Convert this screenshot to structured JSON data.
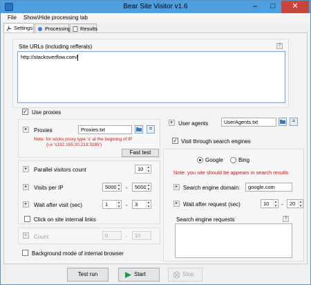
{
  "window": {
    "title": "Bear Site Visitor v1.6"
  },
  "menu": [
    "File",
    "Show\\Hide processing tab"
  ],
  "tabs": [
    "Settings",
    "Processing",
    "Results"
  ],
  "site_urls": {
    "label": "Site URLs (including refferals)",
    "value": "http://stackoverflow.com/"
  },
  "use_proxies": {
    "label": "Use proxies",
    "checked": true
  },
  "proxies": {
    "label": "Proxies",
    "file": "Proxies.txt",
    "note_line1": "Note: for socks proxy type 's' at the begining of IP",
    "note_line2": "(i.e 's192.155.20.213:3185')",
    "fast_test": "Fast test"
  },
  "parallel": {
    "label": "Parallel visitors count",
    "value": "10"
  },
  "visits_per_ip": {
    "label": "Visits per IP",
    "from": "5000",
    "to": "5000",
    "sep": "-"
  },
  "wait_after_visit": {
    "label": "Wait after visit (sec)",
    "from": "1",
    "to": "3",
    "sep": "-"
  },
  "click_internal": {
    "label": "Click on site internal links",
    "checked": false
  },
  "count": {
    "label": "Count",
    "from": "0",
    "to": "10",
    "sep": "-"
  },
  "background_mode": {
    "label": "Background mode of internal browser",
    "checked": false
  },
  "user_agents": {
    "label": "User agents",
    "file": "UserAgents.txt"
  },
  "search_engines": {
    "label": "Visit through search engines",
    "checked": true,
    "google": "Google",
    "bing": "Bing",
    "selected": "Google",
    "note": "Note: you site should be appears in search results",
    "domain_label": "Search engine domain:",
    "domain": "google.com",
    "wait_label": "Wait after request (sec)",
    "wait_from": "10",
    "wait_to": "20",
    "sep": "-",
    "requests_label": "Search engine requests"
  },
  "buttons": {
    "test_run": "Test run",
    "start": "Start",
    "stop": "Stop"
  },
  "colors": {
    "titlebar": "#4e9fe0",
    "note_red": "#d21414",
    "close": "#c8453c"
  }
}
